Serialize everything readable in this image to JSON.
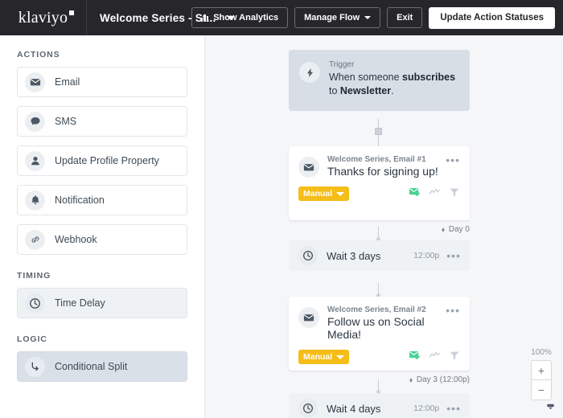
{
  "topbar": {
    "logo_text": "klaviyo",
    "flow_name": "Welcome Series - St...",
    "buttons": {
      "show_analytics": "Show Analytics",
      "manage_flow": "Manage Flow",
      "exit": "Exit",
      "update_action_statuses": "Update Action Statuses"
    }
  },
  "sidebar": {
    "sections": [
      {
        "title": "ACTIONS",
        "items": [
          {
            "label": "Email",
            "icon": "envelope-icon"
          },
          {
            "label": "SMS",
            "icon": "chat-bubble-icon"
          },
          {
            "label": "Update Profile Property",
            "icon": "person-icon"
          },
          {
            "label": "Notification",
            "icon": "bell-icon"
          },
          {
            "label": "Webhook",
            "icon": "link-icon"
          }
        ]
      },
      {
        "title": "TIMING",
        "items": [
          {
            "label": "Time Delay",
            "icon": "clock-icon"
          }
        ]
      },
      {
        "title": "LOGIC",
        "items": [
          {
            "label": "Conditional Split",
            "icon": "branch-icon"
          }
        ]
      }
    ]
  },
  "canvas": {
    "trigger": {
      "label": "Trigger",
      "text_prefix": "When someone ",
      "text_bold_1": "subscribes",
      "text_mid": " to ",
      "text_bold_2": "Newsletter",
      "text_suffix": "."
    },
    "nodes": [
      {
        "type": "email",
        "name": "Welcome Series, Email #1",
        "subject": "Thanks for signing up!",
        "status_badge": "Manual",
        "menu": "•••",
        "day_label": "Day 0"
      },
      {
        "type": "delay",
        "label": "Wait 3 days",
        "time": "12:00p",
        "menu": "•••"
      },
      {
        "type": "email",
        "name": "Welcome Series, Email #2",
        "subject": "Follow us on Social Media!",
        "status_badge": "Manual",
        "menu": "•••",
        "day_label": "Day 3 (12:00p)"
      },
      {
        "type": "delay",
        "label": "Wait 4 days",
        "time": "12:00p",
        "menu": "•••"
      }
    ]
  },
  "zoom_control": {
    "percent": "100%",
    "zoom_in": "+",
    "zoom_out": "−"
  },
  "colors": {
    "topbar_bg": "#27272b",
    "canvas_bg": "#f5f6f8",
    "trigger_bg": "#d7dee6",
    "delay_bg": "#eef2f5",
    "badge_yellow": "#f5bd18",
    "smart_send_green": "#4ad295"
  }
}
